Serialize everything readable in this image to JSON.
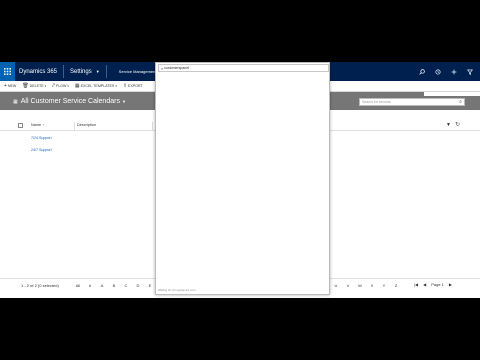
{
  "navbar": {
    "app_title": "Dynamics 365",
    "area": "Settings",
    "subarea": "Service Management",
    "icons": [
      "search-icon",
      "history-icon",
      "plus-icon",
      "filter-icon"
    ]
  },
  "commands": [
    {
      "glyph": "+",
      "label": "NEW",
      "icon": "plus-icon",
      "dropdown": false
    },
    {
      "glyph": "🗑",
      "label": "DELETE",
      "icon": "trash-icon",
      "dropdown": true
    },
    {
      "glyph": "⤤",
      "label": "FLOW",
      "icon": "flow-icon",
      "dropdown": true
    },
    {
      "glyph": "▦",
      "label": "EXCEL TEMPLATES",
      "icon": "excel-icon",
      "dropdown": true
    },
    {
      "glyph": "⇪",
      "label": "EXPORT",
      "icon": "export-icon",
      "dropdown": false
    }
  ],
  "view": {
    "title": "All Customer Service Calendars",
    "search_placeholder": "Search for records"
  },
  "grid": {
    "columns": [
      "Name",
      "Description"
    ],
    "sort_indicator": "↑",
    "rows": [
      {
        "name": "7/24 Support"
      },
      {
        "name": "24/7 Support"
      }
    ]
  },
  "footer": {
    "status": "1 - 2 of 2 (0 selected)",
    "alpha_left": [
      "All",
      "#",
      "A",
      "B",
      "C",
      "D",
      "E"
    ],
    "alpha_right": [
      "U",
      "V",
      "W",
      "X",
      "Y",
      "Z"
    ],
    "page_label": "Page 1"
  },
  "lookup": {
    "query": "customerspanel",
    "footer": "Waiting for crm.dynamics.com..."
  },
  "colors": {
    "navbar": "#002050",
    "waffle": "#0063b1",
    "header_grey": "#767676",
    "link": "#1160b7"
  }
}
